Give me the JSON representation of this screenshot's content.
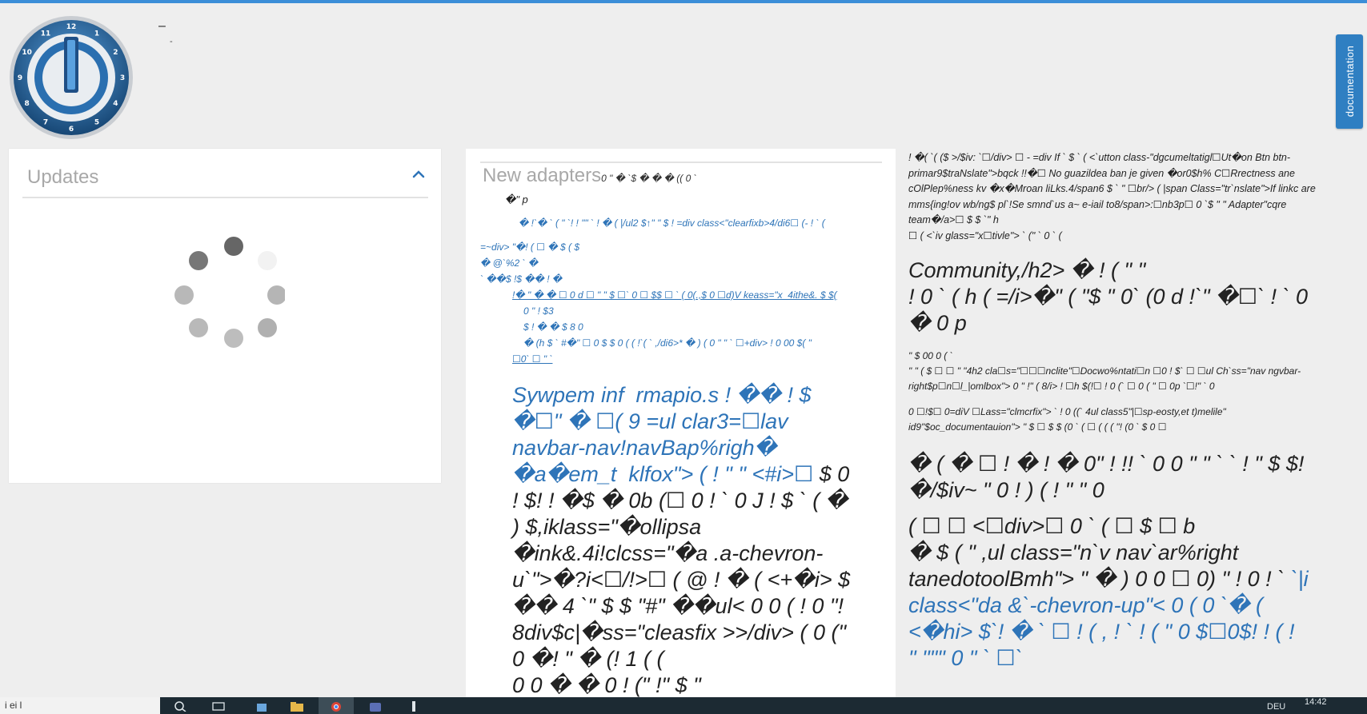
{
  "header": {
    "dash_top": "–",
    "dash_sub": "-"
  },
  "logo": {
    "clock_numbers": [
      "12",
      "1",
      "2",
      "3",
      "4",
      "5",
      "6",
      "7",
      "8",
      "9",
      "10",
      "11"
    ],
    "colors": {
      "ring": "#1f4f86",
      "face": "#2e7cc4",
      "rim": "#c9cdd2"
    }
  },
  "side_tab": {
    "label": "documentation"
  },
  "updates_panel": {
    "title": "Updates",
    "collapse_icon": "chevron-up-icon",
    "loading_icon": "spinner-icon"
  },
  "adapters_panel": {
    "title": "New adapters",
    "title_tail": "0 \" � `$ � � � (( 0 `",
    "lines": [
      "�\" p",
      "� !`� ` ( \" `! ! \"\" ` ! � ( |/ul2 $↑\" \" $ ! =div class<\"clearfixb>4/di6☐ (- ! ` (",
      "=~div> \"�! ( ☐ � $ ( $",
      "� @`%2 ` �",
      "` ��$ !$ �� ! �",
      "!� \" � � ☐ 0 d ☐ \" \" $ ☐` 0 ☐ $$ ☐ ` ( 0(.,$ 0 ☐d)V keass=\"x_4ithe&. $ $(",
      "0 \" ! $3",
      "$ ! � � $ 8 0",
      "� (h $ ` #�\" ☐ 0 $ $ 0 ( ( !`( ` ,/di6>* � ) ( 0 \" \" ` ☐+div> ! 0 00 $( \"",
      "☐0` ☐ \" `"
    ],
    "big_blue": "Sywpem inf  rmapio.s ! �� ! $\n�☐\" � ☐( 9 =ul clar3=☐lav\nnavbar-nav!navBap%righ�\n�a�em_t  klfox\"> ( ! \" \" <#i>☐",
    "big_dark": " $ 0\n! $! ! �$ � 0b (☐ 0 ! ` 0 J ! $ ` ( �\n) $,iklass=\"�ollipsa\n�ink&.4i!clcss=\"�a .a-chevron-\nu`\">�?i<☐/!>☐ ( @ ! � ( <+�i> $\n�� 4 `\" $ $ \"#\" ��ul< 0 0 ( ! 0 \"!\n8div$c|�ss=\"cleasfix >>/div> ( 0 (\"\n0 �! \" � (! 1 ( (\n0 0 � � 0 ! (\" !\" $ \""
  },
  "news_panel": {
    "small_block_1": "! �( `( ($ >/$iv: `☐/div> ☐ - =div If ` $ ` ( <`utton class-\"dgcumeltatigl☐Ut�on Btn btn-\nprimar9$traNslate\">bqck !!�☐ No guazildea ban je given �or0$h% C☐Rrectness ane\ncOlPlep%ness kv �x�Mroan liLks.4/span6 $ ` \" ☐br/> ( |span Class=\"tr`nslate\">If linkc are\nmms{ing!ov wb/ng$ pl`!Se smnd`us a~ e-iail to8/span>:☐nb3p☐ 0 `$ \" \" Adapter\"cqre\nteam�/a>☐ $ $ `\" h\n☐ ( <`iv glass=\"x☐tivle\"> ` (\" ` 0 ` (",
    "heading_1": "Community,/h2> � ! ( \" \"\n! 0 ` ( h ( =/i>�\" ( \"$ \" 0` (0 d !`\" �☐` ! ` 0\n� 0 p",
    "small_block_2": "\" $ 00 0 ( `\n\" \" ( $ ☐ ☐ \" \"4h2 cla☐s=\"☐☐☐nclite\"☐Docwo%ntati☐n ☐0 ! $` ☐ ☐ul Ch`ss=\"nav ngvbar-\nright$p☐n☐l_|omlbox\"> 0 \" !\" ( 8/i> ! ☐h $(!☐ ! 0 (` ☐ 0 ( \" ☐ 0p `☐!\" ` 0",
    "small_block_3": "0 ☐!$☐ 0=diV ☐Lass=\"clmcrfix\"> ` ! 0 ((` 4ul class5\"|☐sp-eosty,et t)melile\"\nid9\"$oc_documentauion\"> \" $ ☐ $ $ (0 ` ( ☐ ( ( ( \"! (0 ` $ 0 ☐",
    "heading_2": "� ( � ☐ ! � ! � 0\" ! !! ` 0 0 \" \" ` ` ! \" $ $!\n�/$iv~ \" 0 ! ) ( ! \" \" 0",
    "heading_3_dark": "( ☐ ☐ <☐div>☐ 0 ` ( ☐ $ ☐ b\n� $ ( \" ,ul class=\"n`v nav`ar%right\ntanedotoolBmh\"> \" � ) 0 0 ☐ 0) \" ! 0 ! ` ",
    "heading_3_blue": "`|i\nclass<\"da &`-chevron-up\"< 0 ( 0 `� (\n<�hi> $`! � ` ☐ ! ( , ! ` ! ( \" 0 $☐0$! ! ( !\n\" \"\"\" 0 \" ` ☐`"
  },
  "taskbar": {
    "left_text": "i ei l",
    "lang": "DEU",
    "time": "14:42",
    "icons": [
      "search-icon",
      "task-view-icon",
      "store-icon",
      "folder-icon",
      "chrome-icon",
      "window-icon",
      "app-icon"
    ]
  }
}
